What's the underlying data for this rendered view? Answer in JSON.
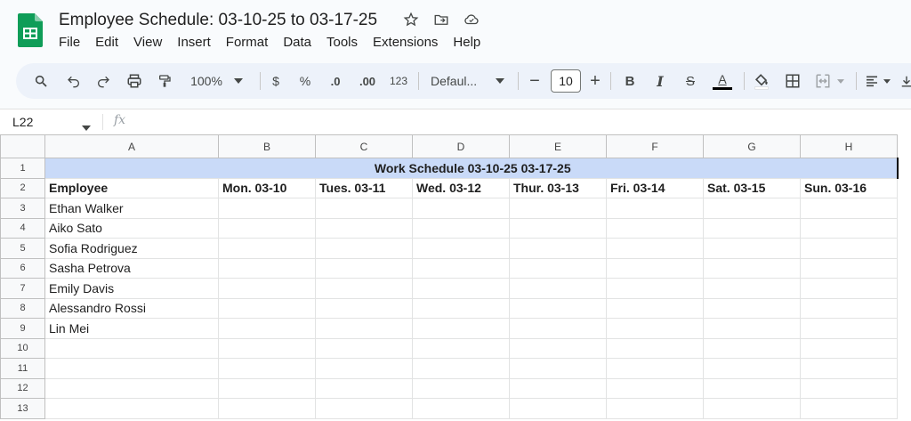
{
  "app": {
    "title": "Employee Schedule: 03-10-25 to 03-17-25",
    "menu": [
      "File",
      "Edit",
      "View",
      "Insert",
      "Format",
      "Data",
      "Tools",
      "Extensions",
      "Help"
    ]
  },
  "toolbar": {
    "zoom": "100%",
    "currency": "$",
    "percent": "%",
    "dec_decrease": ".0",
    "dec_increase": ".00",
    "number_format": "123",
    "font": "Defaul...",
    "font_size": "10",
    "bold": "B",
    "italic": "I",
    "strike": "S",
    "text_color": "A"
  },
  "formula_bar": {
    "cell_ref": "L22",
    "fx": "fx"
  },
  "sheet": {
    "columns": [
      "A",
      "B",
      "C",
      "D",
      "E",
      "F",
      "G",
      "H"
    ],
    "row_numbers": [
      "1",
      "2",
      "3",
      "4",
      "5",
      "6",
      "7",
      "8",
      "9",
      "10",
      "11",
      "12",
      "13"
    ],
    "title_cell": "Work Schedule 03-10-25 03-17-25",
    "headers": [
      "Employee",
      "Mon. 03-10",
      "Tues. 03-11",
      "Wed. 03-12",
      "Thur. 03-13",
      "Fri. 03-14",
      "Sat. 03-15",
      "Sun. 03-16"
    ],
    "employees": [
      "Ethan Walker",
      "Aiko Sato",
      "Sofia Rodriguez",
      "Sasha Petrova",
      "Emily Davis",
      "Alessandro Rossi",
      "Lin Mei"
    ]
  },
  "colors": {
    "title_fill": "#c9daf8",
    "logo_green": "#0f9d58"
  }
}
